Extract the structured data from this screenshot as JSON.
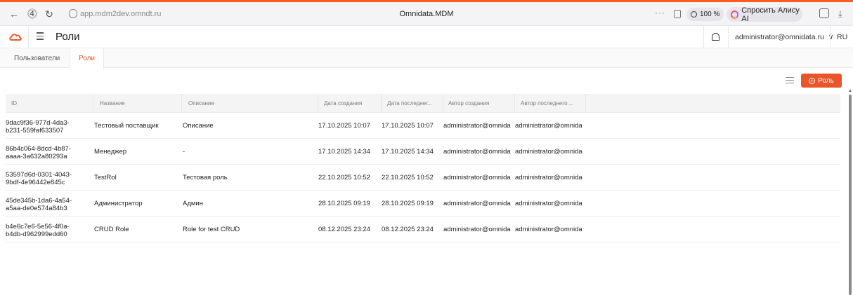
{
  "browser": {
    "url": "app.mdm2dev.omndt.ru",
    "page_title": "Omnidata.MDM",
    "zoom": "100 %",
    "alice_label": "Спросить Алису AI",
    "dots": "···"
  },
  "header": {
    "title": "Роли",
    "user": "administrator@omnidata.ru",
    "lang": "RU"
  },
  "tabs": [
    {
      "label": "Пользователи",
      "active": false
    },
    {
      "label": "Роли",
      "active": true
    }
  ],
  "toolbar": {
    "add_role_label": "Роль"
  },
  "table": {
    "columns": [
      "ID",
      "Название",
      "Описание",
      "Дата создания",
      "Дата последнег...",
      "Автор создания",
      "Автор последнего ..."
    ],
    "rows": [
      {
        "id1": "9dac9f36-977d-4da3-",
        "id2": "b231-559faf633507",
        "name": "Тестовый поставщик",
        "desc": "Описание",
        "created": "17.10.2025 10:07",
        "updated": "17.10.2025 10:07",
        "author": "administrator@omnida",
        "editor": "administrator@omnida"
      },
      {
        "id1": "86b4c064-8dcd-4b87-",
        "id2": "aaaa-3a632a80293a",
        "name": "Менеджер",
        "desc": "-",
        "created": "17.10.2025 14:34",
        "updated": "17.10.2025 14:34",
        "author": "administrator@omnida",
        "editor": "administrator@omnida"
      },
      {
        "id1": "53597d6d-0301-4043-",
        "id2": "9bdf-4e96442e845c",
        "name": "TestRol",
        "desc": "Тестовая роль",
        "created": "22.10.2025 10:52",
        "updated": "22.10.2025 10:52",
        "author": "administrator@omnida",
        "editor": "administrator@omnida"
      },
      {
        "id1": "45de345b-1da6-4a54-",
        "id2": "a5aa-de0e574a84b3",
        "name": "Администратор",
        "desc": "Админ",
        "created": "28.10.2025 09:19",
        "updated": "28.10.2025 09:19",
        "author": "administrator@omnida",
        "editor": "administrator@omnida"
      },
      {
        "id1": "b4e6c7e6-5e56-4f0a-",
        "id2": "b4db-d962999edd60",
        "name": "CRUD Role",
        "desc": "Role for test CRUD",
        "created": "08.12.2025 23:24",
        "updated": "08.12.2025 23:24",
        "author": "administrator@omnida",
        "editor": "administrator@omnida"
      }
    ]
  },
  "colors": {
    "accent": "#e8552b",
    "top_bar": "#ff5a1f"
  }
}
